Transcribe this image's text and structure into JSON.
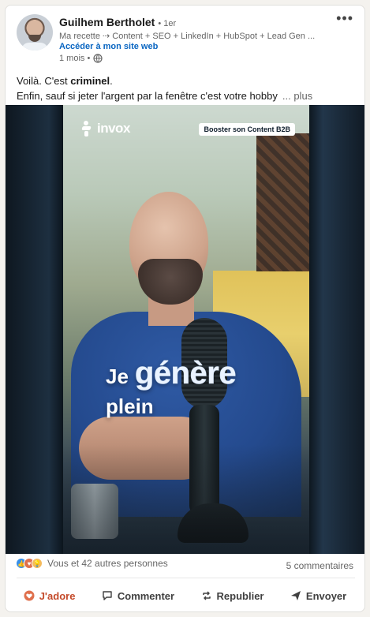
{
  "post": {
    "author": {
      "name": "Guilhem Bertholet",
      "degree": "• 1er",
      "headline": "Ma recette ⇢ Content + SEO + LinkedIn + HubSpot + Lead Gen ...",
      "site_link": "Accéder à mon site web",
      "time": "1 mois •"
    },
    "text": {
      "line1_prefix": "Voilà. C'est ",
      "line1_bold": "criminel",
      "line1_suffix": ".",
      "line2": "Enfin, sauf si jeter l'argent par la fenêtre c'est votre hobby",
      "more": "... plus"
    },
    "video": {
      "logo": "invox",
      "badge": "Booster son Content B2B",
      "caption_word1": "Je",
      "caption_word2": "génère",
      "caption_line2": "plein"
    },
    "social": {
      "reactions_text": "Vous et 42 autres personnes",
      "comments": "5 commentaires"
    },
    "actions": {
      "like": "J'adore",
      "comment": "Commenter",
      "repost": "Republier",
      "send": "Envoyer"
    },
    "colors": {
      "link_blue": "#0a66c2",
      "liked_red": "#c44a2a"
    }
  }
}
